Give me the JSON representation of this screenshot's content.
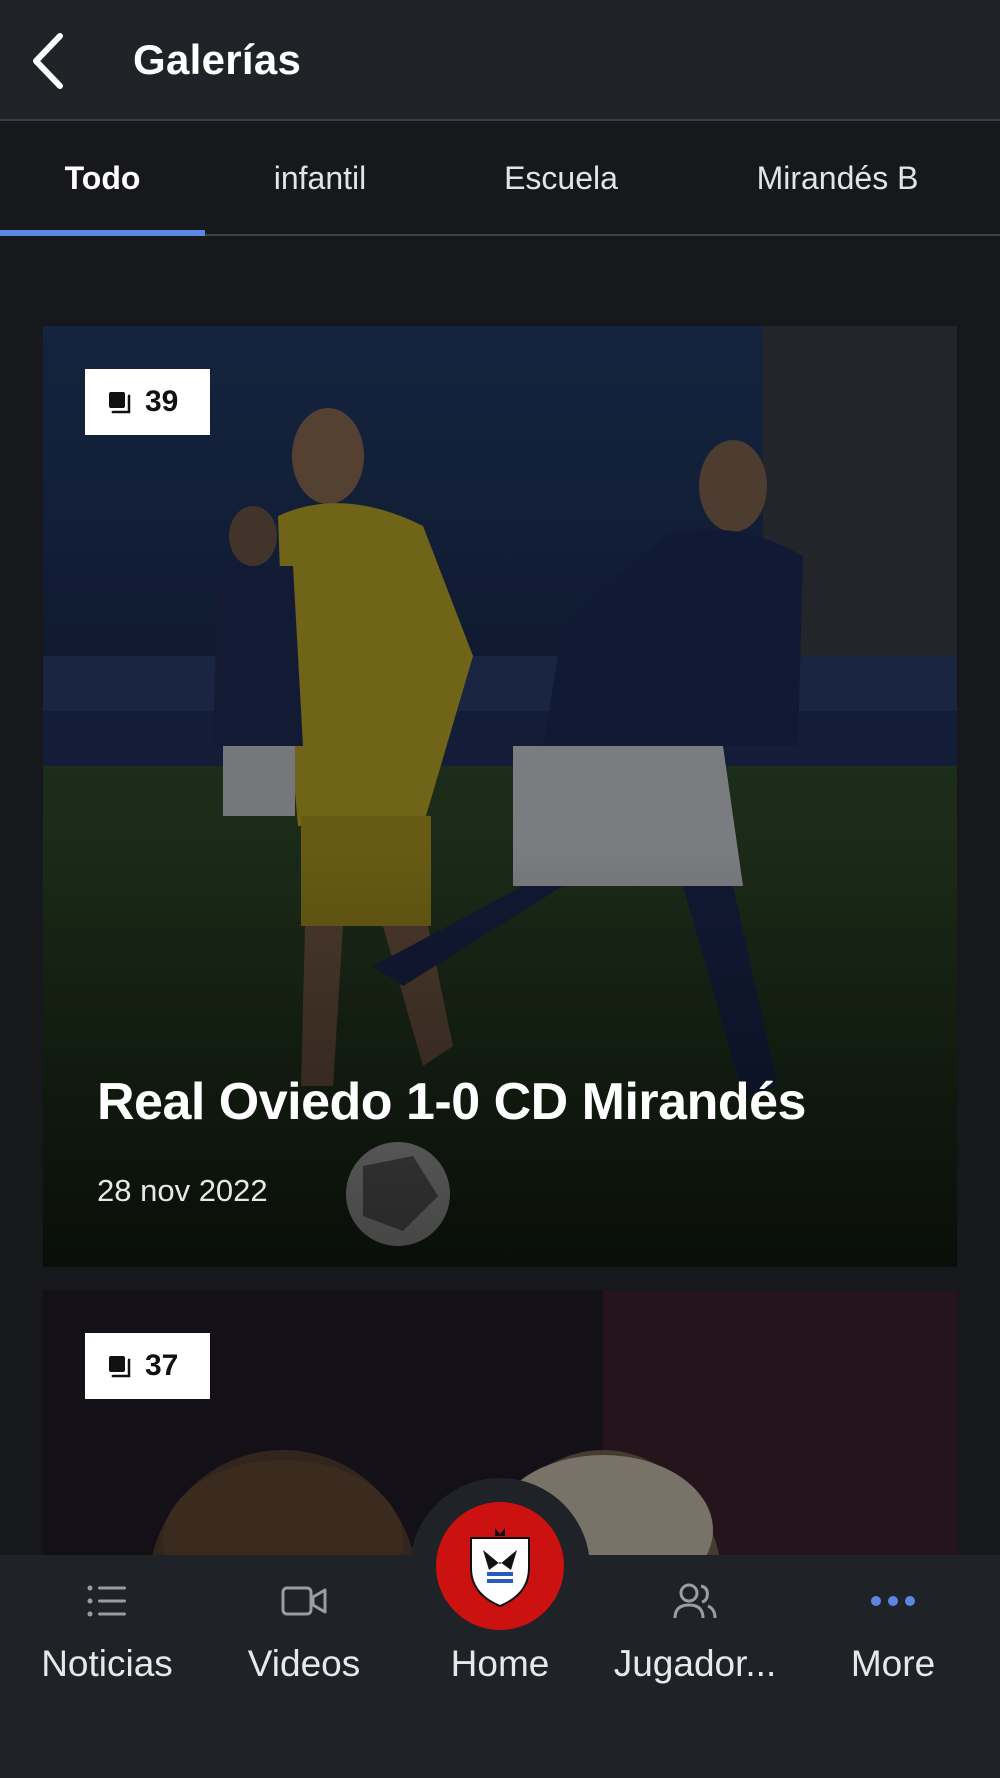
{
  "header": {
    "title": "Galerías"
  },
  "tabs": [
    {
      "label": "Todo"
    },
    {
      "label": "infantil"
    },
    {
      "label": "Escuela"
    },
    {
      "label": "Mirandés B"
    }
  ],
  "galleries": [
    {
      "count": "39",
      "title": "Real Oviedo 1-0 CD Mirandés",
      "date": "28 nov 2022"
    },
    {
      "count": "37"
    }
  ],
  "bottom_nav": {
    "noticias": "Noticias",
    "videos": "Videos",
    "home": "Home",
    "jugadores": "Jugador...",
    "more": "More"
  },
  "colors": {
    "accent": "#5b87e0",
    "home_button": "#cc1111",
    "header_bg": "#1f2226",
    "page_bg": "#16181b"
  }
}
